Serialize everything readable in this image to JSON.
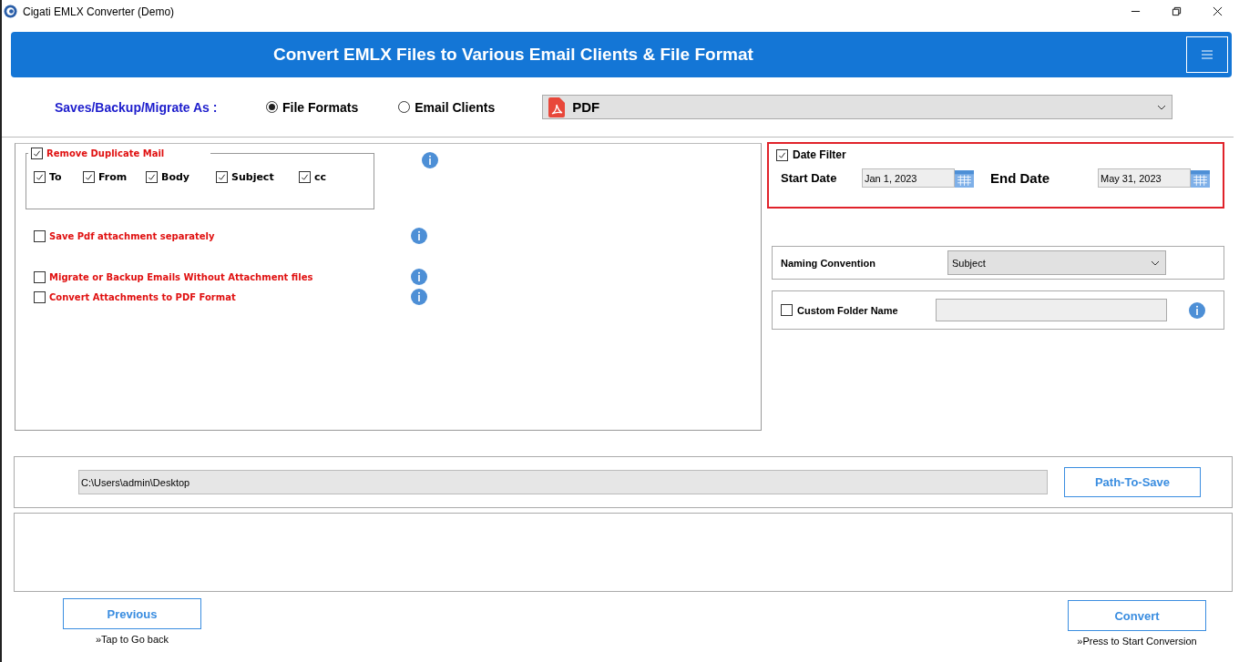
{
  "window": {
    "title": "Cigati EMLX Converter (Demo)"
  },
  "header": {
    "title": "Convert EMLX Files to Various Email Clients & File Format"
  },
  "save_as": {
    "label": "Saves/Backup/Migrate As :",
    "options": [
      {
        "label": "File Formats",
        "selected": true
      },
      {
        "label": "Email Clients",
        "selected": false
      }
    ],
    "format": "PDF"
  },
  "duplicate_filter": {
    "label": "Remove Duplicate Mail",
    "checked": true,
    "fields": [
      {
        "label": "To",
        "checked": true
      },
      {
        "label": "From",
        "checked": true
      },
      {
        "label": "Body",
        "checked": true
      },
      {
        "label": "Subject",
        "checked": true
      },
      {
        "label": "cc",
        "checked": true
      }
    ]
  },
  "options": [
    {
      "label": "Save Pdf attachment separately",
      "checked": false
    },
    {
      "label": "Migrate or Backup Emails Without Attachment files",
      "checked": false
    },
    {
      "label": "Convert Attachments to PDF Format",
      "checked": false
    }
  ],
  "date_filter": {
    "label": "Date Filter",
    "checked": true,
    "start_label": "Start Date",
    "start_value": "Jan 1, 2023",
    "end_label": "End Date",
    "end_value": "May 31, 2023"
  },
  "naming_convention": {
    "label": "Naming Convention",
    "value": "Subject"
  },
  "custom_folder": {
    "label": "Custom Folder Name",
    "checked": false
  },
  "destination": {
    "path": "C:\\Users\\admin\\Desktop",
    "button": "Path-To-Save"
  },
  "navigation": [
    {
      "button": "Previous",
      "hint": "»Tap to Go back"
    },
    {
      "button": "Convert",
      "hint": "»Press to Start Conversion"
    }
  ]
}
